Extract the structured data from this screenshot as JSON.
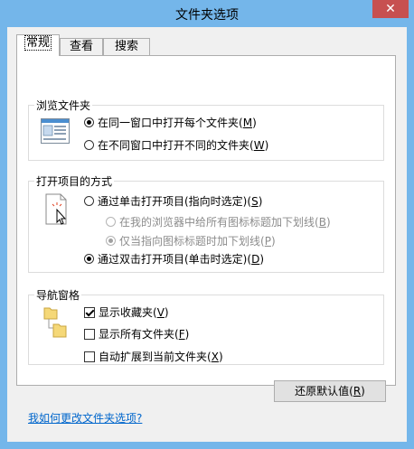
{
  "window": {
    "title": "文件夹选项",
    "close_symbol": "✕"
  },
  "tabs": [
    {
      "label": "常规",
      "active": true
    },
    {
      "label": "查看",
      "active": false
    },
    {
      "label": "搜索",
      "active": false
    }
  ],
  "browse_folders": {
    "legend": "浏览文件夹",
    "options": [
      {
        "text": "在同一窗口中打开每个文件夹",
        "key": "M",
        "selected": true
      },
      {
        "text": "在不同窗口中打开不同的文件夹",
        "key": "W",
        "selected": false
      }
    ]
  },
  "open_items": {
    "legend": "打开项目的方式",
    "single_click": {
      "text": "通过单击打开项目(指向时选定)",
      "key": "S",
      "selected": false
    },
    "sub_options": [
      {
        "text": "在我的浏览器中给所有图标标题加下划线",
        "key": "B",
        "selected": false
      },
      {
        "text": "仅当指向图标标题时加下划线",
        "key": "P",
        "selected": true
      }
    ],
    "double_click": {
      "text": "通过双击打开项目(单击时选定)",
      "key": "D",
      "selected": true
    }
  },
  "navigation_pane": {
    "legend": "导航窗格",
    "options": [
      {
        "text": "显示收藏夹",
        "key": "V",
        "checked": true
      },
      {
        "text": "显示所有文件夹",
        "key": "F",
        "checked": false
      },
      {
        "text": "自动扩展到当前文件夹",
        "key": "X",
        "checked": false
      }
    ]
  },
  "buttons": {
    "restore_defaults": "还原默认值",
    "restore_defaults_key": "R"
  },
  "help_link": "我如何更改文件夹选项?",
  "colors": {
    "titlebar": "#74b6ea",
    "close": "#c75050",
    "link": "#0066cc",
    "folder": "#f5d878"
  }
}
